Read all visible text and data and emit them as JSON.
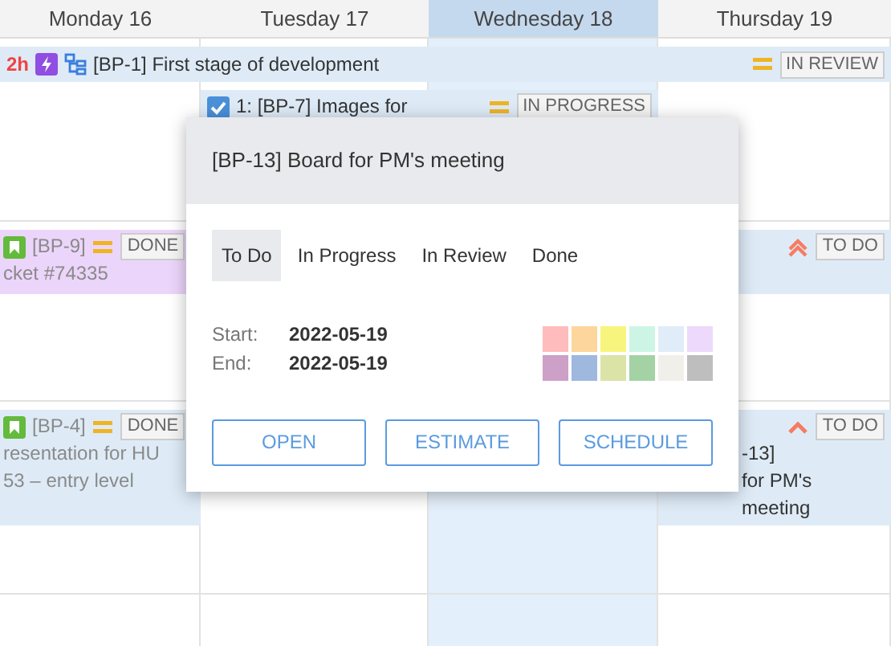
{
  "days": [
    {
      "label": "Monday 16",
      "selected": false
    },
    {
      "label": "Tuesday 17",
      "selected": false
    },
    {
      "label": "Wednesday 18",
      "selected": true
    },
    {
      "label": "Thursday 19",
      "selected": false
    }
  ],
  "weeks": [
    {
      "events": [
        {
          "kind": "week",
          "estimate": "2h",
          "type_icon": {
            "kind": "epic"
          },
          "has_children": true,
          "lines": [
            "[BP-1] First stage of development"
          ],
          "priority_icon": {
            "kind": "medium"
          },
          "status": "IN REVIEW",
          "done": false,
          "color": "#deebf7"
        },
        {
          "kind": "midweek",
          "checked": true,
          "lines": [
            "1: [BP-7] Images for"
          ],
          "priority_icon": {
            "kind": "medium"
          },
          "status": "IN PROGRESS",
          "done": false,
          "color": "#deebf7"
        }
      ]
    },
    {
      "events": [
        {
          "kind": "monday",
          "type_icon": {
            "kind": "story"
          },
          "lines": [
            "[BP-9]",
            "cket #74335"
          ],
          "priority_icon": {
            "kind": "medium"
          },
          "status": "DONE",
          "done": true,
          "color": "#ecd5fa"
        },
        {
          "kind": "thursday",
          "priority_icon": {
            "kind": "highest"
          },
          "status": "TO DO",
          "done": false,
          "color": "#deebf7"
        }
      ]
    },
    {
      "events": [
        {
          "kind": "monday",
          "type_icon": {
            "kind": "story"
          },
          "lines": [
            "[BP-4]",
            "resentation for HU",
            "53 – entry level"
          ],
          "priority_icon": {
            "kind": "medium"
          },
          "status": "DONE",
          "done": true,
          "color": "#deebf7"
        },
        {
          "kind": "thursday",
          "lines": [
            "-13]",
            "for PM's",
            "meeting"
          ],
          "priority_icon": {
            "kind": "high"
          },
          "status": "TO DO",
          "done": false,
          "color": "#deebf7"
        }
      ]
    }
  ],
  "popup": {
    "title": "[BP-13] Board for PM's meeting",
    "tabs": [
      {
        "label": "To Do",
        "selected": true
      },
      {
        "label": "In Progress",
        "selected": false
      },
      {
        "label": "In Review",
        "selected": false
      },
      {
        "label": "Done",
        "selected": false
      }
    ],
    "dates": [
      {
        "label": "Start:",
        "value": "2022-05-19"
      },
      {
        "label": "End:",
        "value": "2022-05-19"
      }
    ],
    "swatches": [
      {
        "color": "#ffbcbc"
      },
      {
        "color": "#fcd69c"
      },
      {
        "color": "#f7f57e"
      },
      {
        "color": "#cdf5e6"
      },
      {
        "color": "#e0edf8"
      },
      {
        "color": "#ecd9fb"
      },
      {
        "color": "#cda0c8"
      },
      {
        "color": "#9fb8de"
      },
      {
        "color": "#dbe3a6"
      },
      {
        "color": "#a3d3a4"
      },
      {
        "color": "#f1efe9"
      },
      {
        "color": "#bebebe"
      }
    ],
    "buttons": [
      "OPEN",
      "ESTIMATE",
      "SCHEDULE"
    ]
  }
}
